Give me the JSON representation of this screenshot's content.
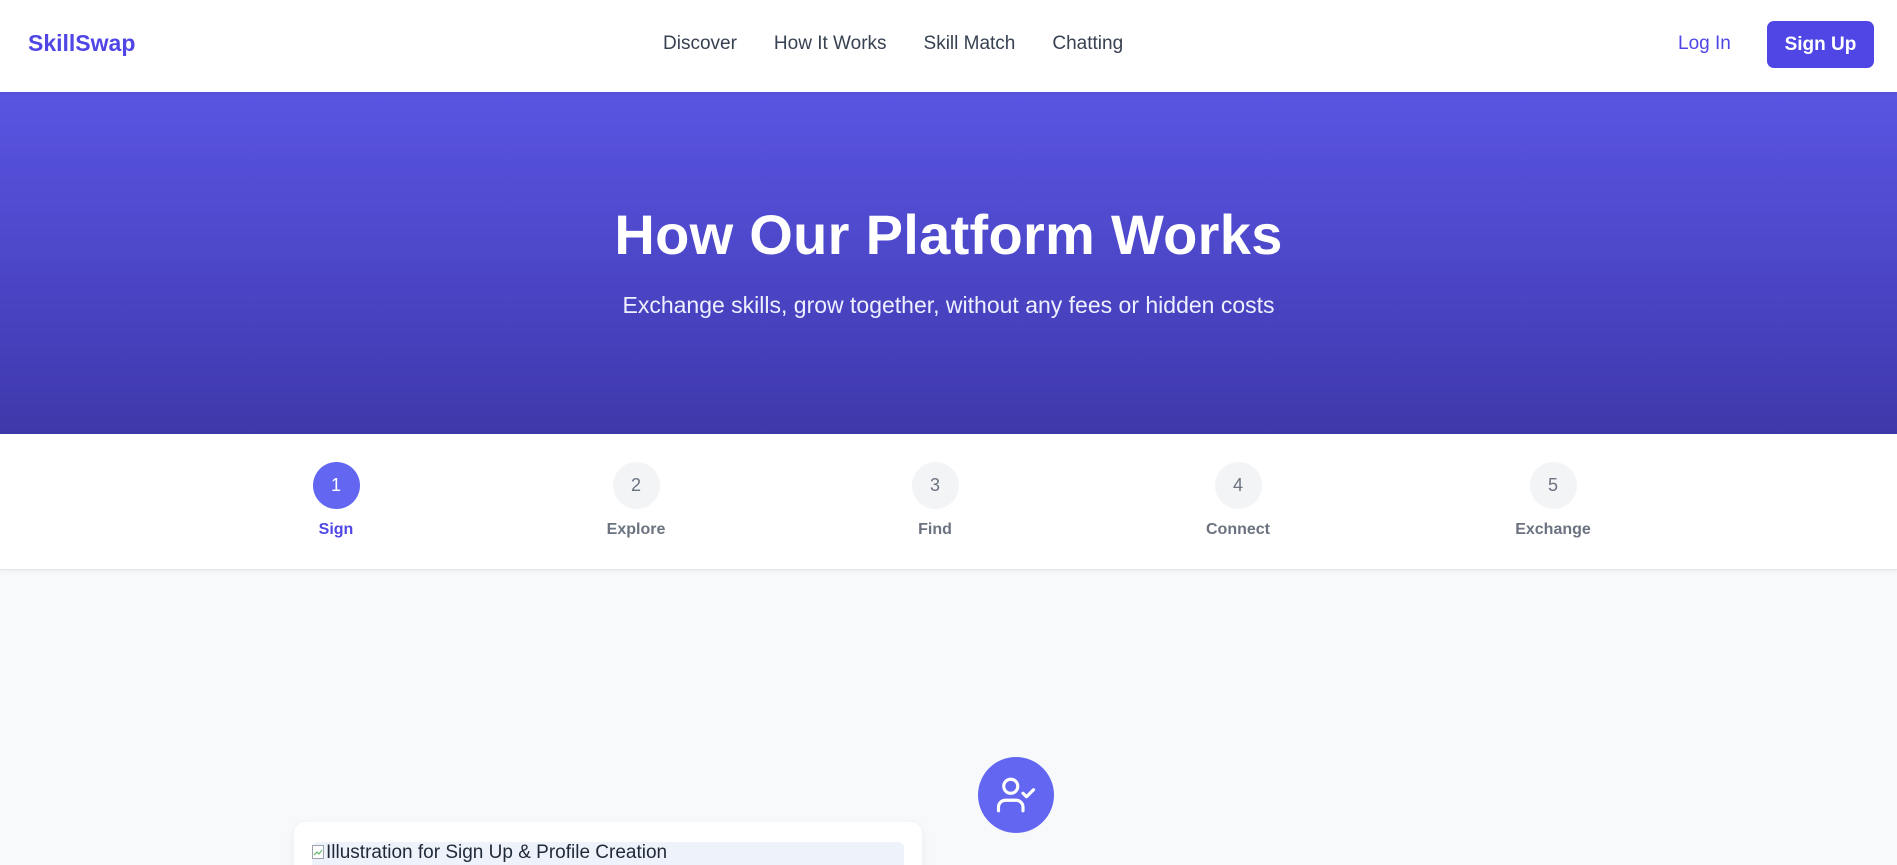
{
  "header": {
    "logo": "SkillSwap",
    "nav": [
      "Discover",
      "How It Works",
      "Skill Match",
      "Chatting"
    ],
    "login_label": "Log In",
    "signup_label": "Sign Up"
  },
  "hero": {
    "title": "How Our Platform Works",
    "subtitle": "Exchange skills, grow together, without any fees or hidden costs"
  },
  "steps": [
    {
      "number": "1",
      "label": "Sign",
      "active": true
    },
    {
      "number": "2",
      "label": "Explore",
      "active": false
    },
    {
      "number": "3",
      "label": "Find",
      "active": false
    },
    {
      "number": "4",
      "label": "Connect",
      "active": false
    },
    {
      "number": "5",
      "label": "Exchange",
      "active": false
    }
  ],
  "content": {
    "icon": "user-check-icon",
    "image_alt": "Illustration for Sign Up & Profile Creation"
  },
  "colors": {
    "accent": "#4f46e5",
    "step_active": "#6366f1",
    "hero_top": "#5a55e2",
    "hero_bottom": "#3f38aa"
  }
}
